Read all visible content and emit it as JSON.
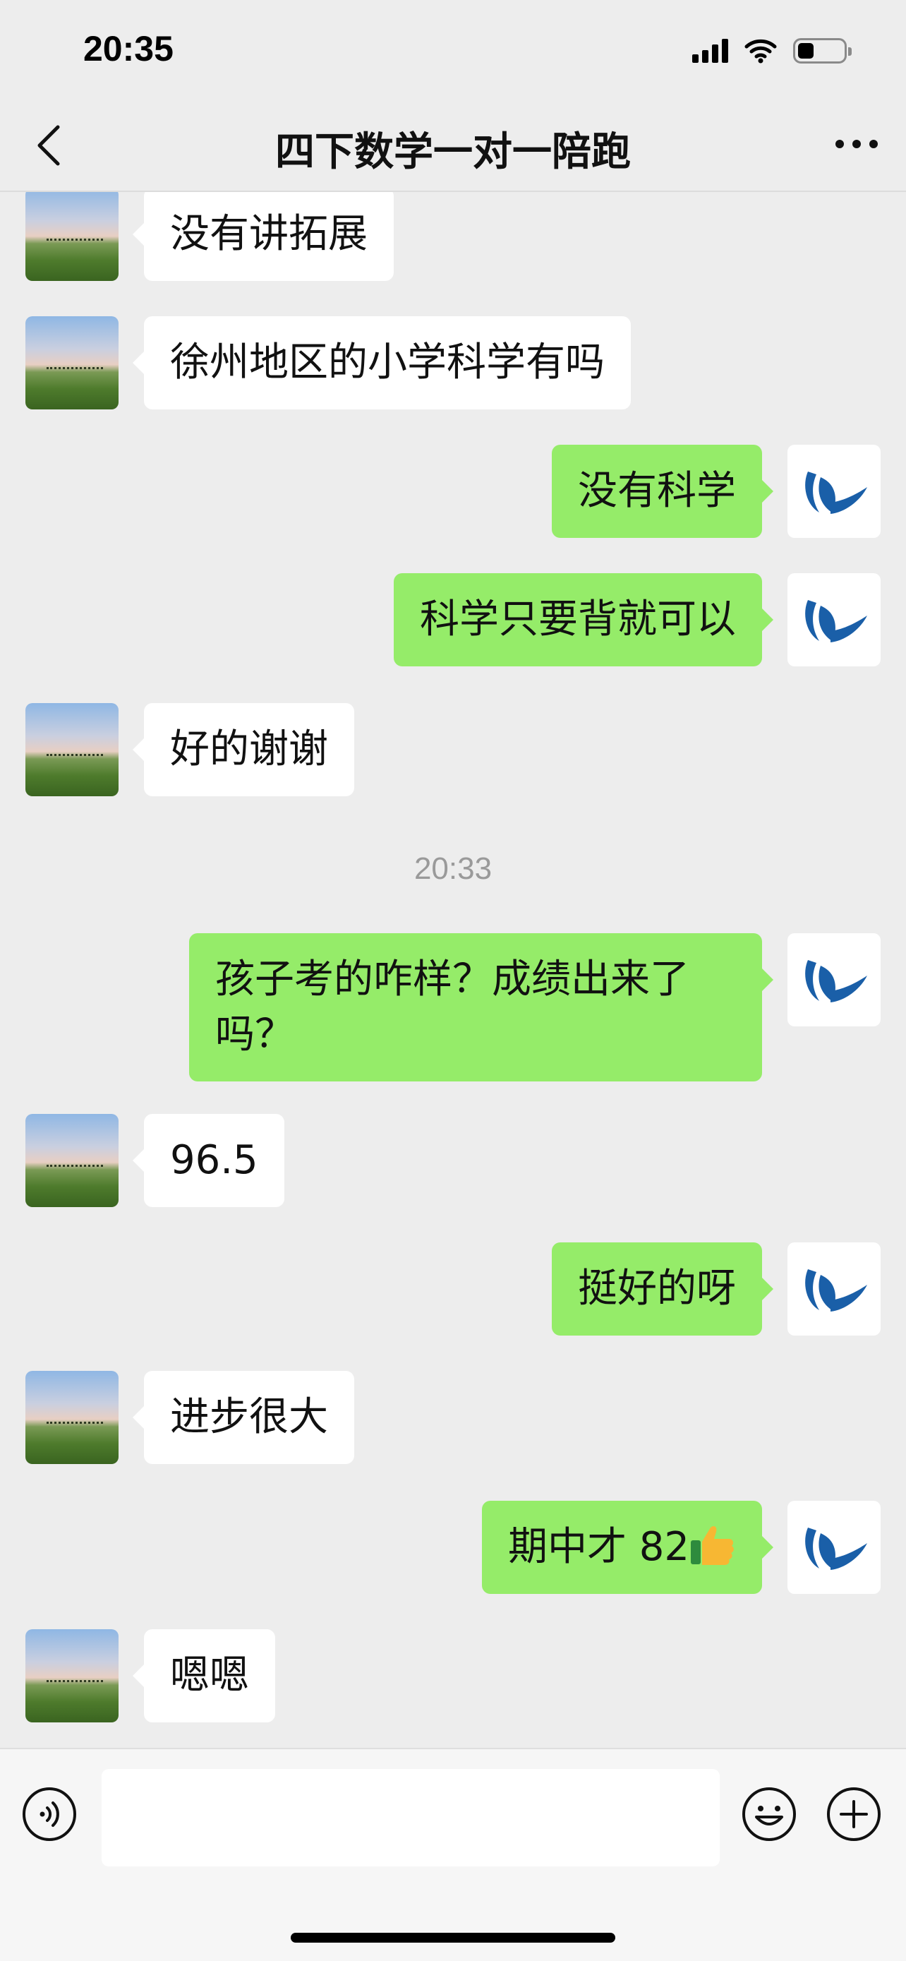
{
  "status_bar": {
    "time": "20:35",
    "battery_level": 0.35
  },
  "header": {
    "title": "四下数学一对一陪跑"
  },
  "messages": [
    {
      "side": "left",
      "text": "没有讲拓展"
    },
    {
      "side": "left",
      "text": "徐州地区的小学科学有吗"
    },
    {
      "side": "right",
      "text": "没有科学"
    },
    {
      "side": "right",
      "text": "科学只要背就可以"
    },
    {
      "side": "left",
      "text": "好的谢谢"
    },
    {
      "timestamp": "20:33"
    },
    {
      "side": "right",
      "text": "孩子考的咋样？成绩出来了吗？"
    },
    {
      "side": "left",
      "text": "96.5"
    },
    {
      "side": "right",
      "text": "挺好的呀"
    },
    {
      "side": "left",
      "text": "进步很大"
    },
    {
      "side": "right",
      "text": "期中才 82",
      "emoji": "thumbs-up"
    },
    {
      "side": "left",
      "text": "嗯嗯"
    }
  ],
  "input": {
    "value": "",
    "placeholder": ""
  },
  "icons": {
    "back": "chevron-left-icon",
    "more": "more-dots-icon",
    "voice": "voice-icon",
    "emoji": "emoji-icon",
    "plus": "plus-icon"
  },
  "colors": {
    "own_bubble": "#95ec69",
    "other_bubble": "#ffffff",
    "background": "#ededed"
  }
}
